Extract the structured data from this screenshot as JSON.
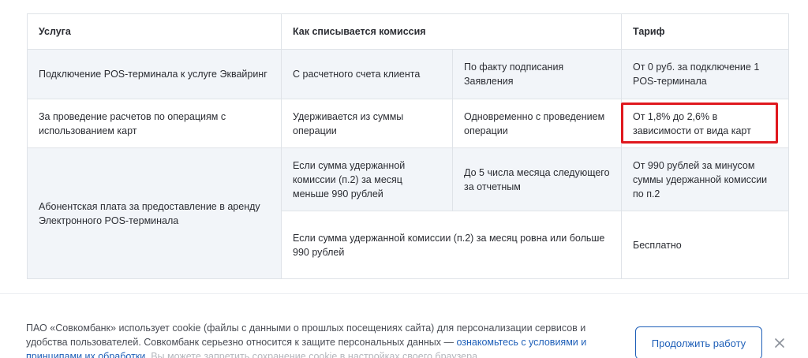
{
  "table": {
    "headers": {
      "service": "Услуга",
      "how_charged": "Как списывается комиссия",
      "tariff": "Тариф"
    },
    "rows": [
      {
        "service": "Подключение POS-терминала к услуге Эквайринг",
        "source": "С расчетного счета клиента",
        "timing": "По факту подписания Заявления",
        "tariff": "От 0 руб. за подключение 1 POS-терминала"
      },
      {
        "service": "За проведение расчетов по операциям с использованием карт",
        "source": "Удерживается из суммы операции",
        "timing": "Одновременно с проведением операции",
        "tariff": "От 1,8% до 2,6% в зависимости от вида карт"
      },
      {
        "service": "Абонентская плата за предоставление в аренду Электронного POS-терминала",
        "source": "Если сумма удержанной комиссии (п.2) за месяц меньше 990 рублей",
        "timing": "До 5 числа месяца следующего за отчетным",
        "tariff": "От 990 рублей за минусом суммы удержанной комиссии по п.2"
      },
      {
        "condition": "Если сумма удержанной комиссии (п.2) за месяц ровна или больше 990 рублей",
        "tariff": "Бесплатно"
      }
    ]
  },
  "cookie": {
    "text_part1": "ПАО «Совкомбанк» использует cookie (файлы с данными о прошлых посещениях сайта) для персонализации сервисов и удобства пользователей. Совкомбанк серьезно относится к защите персональных данных — ",
    "link_text": "ознакомьтесь с условиями и принципами их обработки",
    "text_part2": ". Вы можете запретить сохранение cookie в настройках своего браузера.",
    "button_label": "Продолжить работу"
  },
  "colors": {
    "highlight": "#e0181e",
    "accent": "#1e5fb8"
  },
  "icons": {
    "close": "close-icon"
  }
}
